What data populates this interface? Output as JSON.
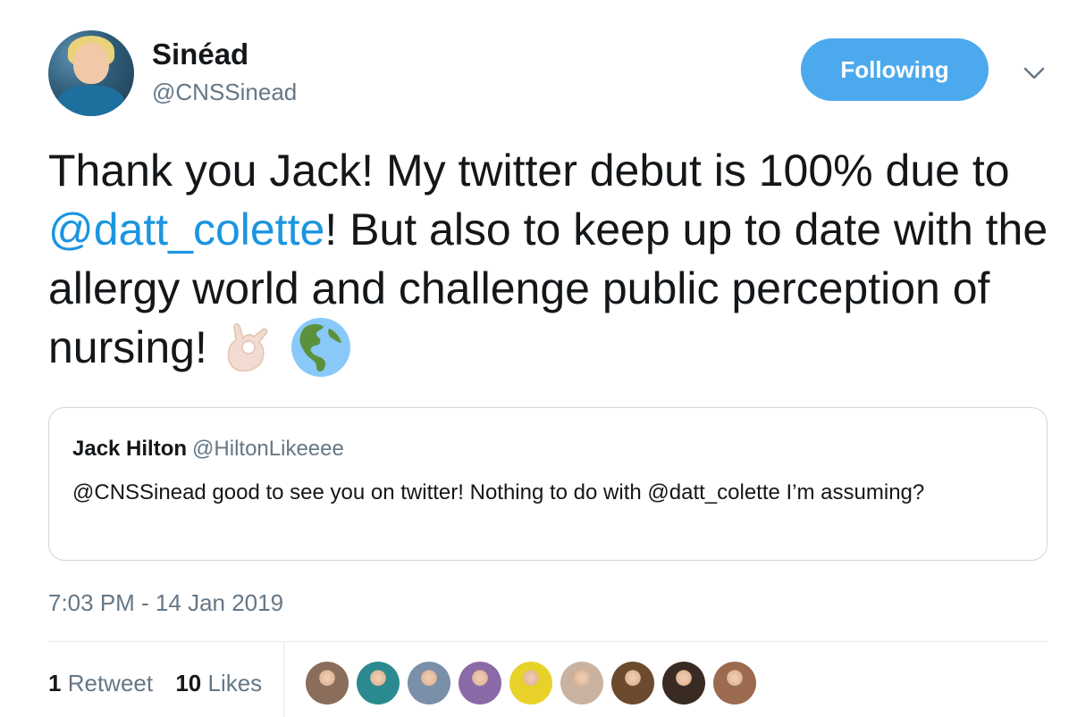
{
  "author": {
    "name": "Sinéad",
    "handle": "@CNSSinead"
  },
  "follow_button": {
    "label": "Following"
  },
  "tweet": {
    "text_part1": "Thank you Jack! My twitter debut is 100% due to ",
    "mention": "@datt_colette",
    "text_part2": "! But also to keep up to date with the allergy world and challenge public perception of nursing! "
  },
  "quoted_tweet": {
    "name": "Jack Hilton",
    "handle": "@HiltonLikeeee",
    "text": "@CNSSinead good to see you on twitter! Nothing to do with @datt_colette I’m assuming?"
  },
  "timestamp": "7:03 PM - 14 Jan 2019",
  "stats": {
    "retweet_count": "1",
    "retweet_label": "Retweet",
    "like_count": "10",
    "like_label": "Likes"
  },
  "colors": {
    "accent": "#1b95e0",
    "follow_button_bg": "#4ca9ee",
    "secondary_text": "#657786",
    "border": "#ccd6dd"
  },
  "icons": {
    "ok_hand": "ok-hand-emoji",
    "globe": "globe-americas-emoji",
    "caret": "chevron-down-icon"
  },
  "likers": [
    {
      "avatar": "liker-avatar-1",
      "color": "#8a6d5a"
    },
    {
      "avatar": "liker-avatar-2",
      "color": "#2a8a8f"
    },
    {
      "avatar": "liker-avatar-3",
      "color": "#7a8fa8"
    },
    {
      "avatar": "liker-avatar-4",
      "color": "#8b6aa8"
    },
    {
      "avatar": "liker-avatar-5",
      "color": "#e8d22a"
    },
    {
      "avatar": "liker-avatar-6",
      "color": "#c9b2a0"
    },
    {
      "avatar": "liker-avatar-7",
      "color": "#6b4a2e"
    },
    {
      "avatar": "liker-avatar-8",
      "color": "#3a2a24"
    },
    {
      "avatar": "liker-avatar-9",
      "color": "#9c6a4e"
    }
  ]
}
